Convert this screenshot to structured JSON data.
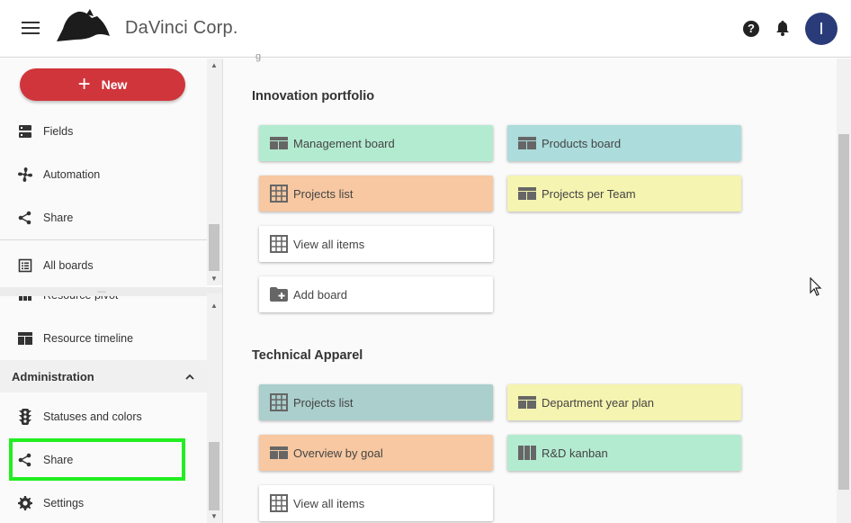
{
  "app": {
    "brand": "DaVinci Corp.",
    "avatar_initial": "I",
    "help_symbol": "?"
  },
  "sidebar": {
    "new_button": "New",
    "new_plus": "+",
    "top_items": [
      {
        "label": "Fields",
        "icon": "fields-icon"
      },
      {
        "label": "Automation",
        "icon": "automation-icon"
      },
      {
        "label": "Share",
        "icon": "share-icon"
      }
    ],
    "all_boards": "All boards",
    "partial_item": "Resource pivot",
    "resource_timeline": "Resource timeline",
    "admin_header": "Administration",
    "admin_items": [
      {
        "label": "Statuses and colors",
        "icon": "traffic-light-icon"
      },
      {
        "label": "Share",
        "icon": "share-icon"
      },
      {
        "label": "Settings",
        "icon": "gear-icon"
      }
    ]
  },
  "main": {
    "tiny_text": "g",
    "sections": [
      {
        "title": "Innovation portfolio",
        "cards": [
          {
            "label": "Management board",
            "icon": "board-icon",
            "color": "#b3ebd1"
          },
          {
            "label": "Products board",
            "icon": "board-icon",
            "color": "#acdcdc"
          },
          {
            "label": "Projects list",
            "icon": "grid-icon",
            "color": "#f7c8a1"
          },
          {
            "label": "Projects per Team",
            "icon": "board-icon",
            "color": "#f5f4b0"
          },
          {
            "label": "View all items",
            "icon": "grid-icon",
            "color": "#ffffff"
          },
          {
            "label": "Add board",
            "icon": "add-folder-icon",
            "color": "#ffffff"
          }
        ]
      },
      {
        "title": "Technical Apparel",
        "cards": [
          {
            "label": "Projects list",
            "icon": "grid-icon",
            "color": "#aacfcc"
          },
          {
            "label": "Department year plan",
            "icon": "board-icon",
            "color": "#f5f4b0"
          },
          {
            "label": "Overview by goal",
            "icon": "board-icon",
            "color": "#f7c8a1"
          },
          {
            "label": "R&D kanban",
            "icon": "kanban-icon",
            "color": "#b3ebd1"
          },
          {
            "label": "View all items",
            "icon": "grid-icon",
            "color": "#ffffff"
          }
        ]
      }
    ]
  },
  "colors": {
    "accent_red": "#d0353b",
    "avatar_blue": "#2a3b7a",
    "highlight_green": "#22ee22"
  }
}
